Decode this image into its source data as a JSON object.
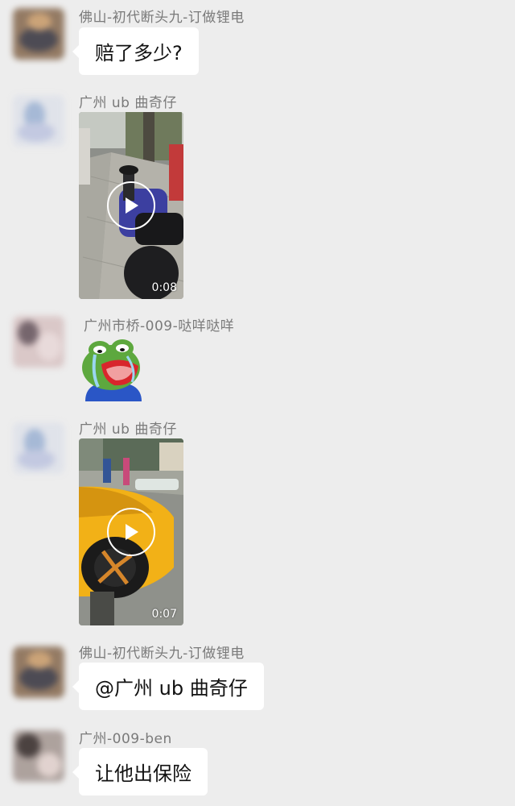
{
  "messages": [
    {
      "sender": "佛山-初代断头九-订做锂电",
      "type": "text",
      "text": "赔了多少?",
      "avatar": "blurred-avatar-brown"
    },
    {
      "sender": "广州 ub 曲奇仔",
      "type": "video",
      "duration": "0:08",
      "thumbnail": "motorcycle-on-sidewalk",
      "avatar": "blurred-avatar-blue"
    },
    {
      "sender": "广州市桥-009-哒咩哒咩",
      "type": "sticker",
      "sticker": "crying-frog-sticker",
      "avatar": "blurred-avatar-pink"
    },
    {
      "sender": "广州 ub 曲奇仔",
      "type": "video",
      "duration": "0:07",
      "thumbnail": "yellow-sports-car",
      "avatar": "blurred-avatar-blue"
    },
    {
      "sender": "佛山-初代断头九-订做锂电",
      "type": "text",
      "text": "@广州 ub 曲奇仔",
      "avatar": "blurred-avatar-brown"
    },
    {
      "sender": "广州-009-ben",
      "type": "text",
      "text": "让他出保险",
      "avatar": "blurred-avatar-dark"
    }
  ],
  "colors": {
    "background": "#ededed",
    "bubble": "#ffffff",
    "sender_text": "#7a7a7a",
    "play_icon": "#ffffff"
  }
}
